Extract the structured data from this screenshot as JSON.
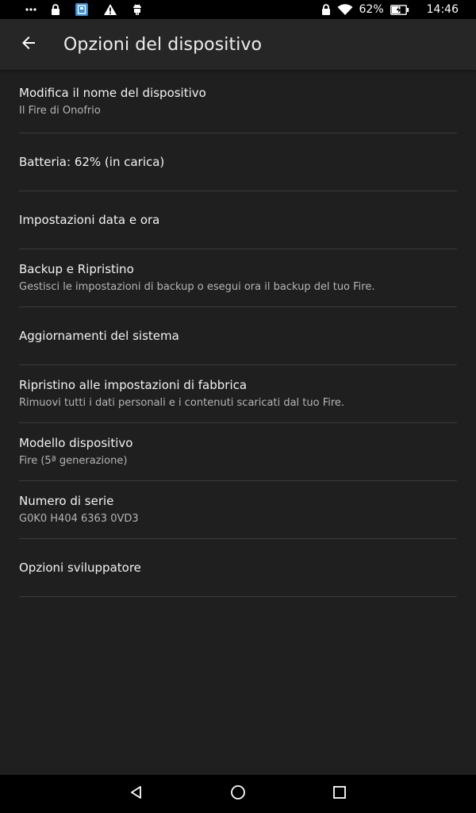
{
  "status_bar": {
    "icons_left": [
      "more-dots-icon",
      "lock-icon",
      "kindle-store-icon",
      "warning-icon",
      "android-debug-icon"
    ],
    "icons_right": [
      "lock-icon",
      "wifi-icon"
    ],
    "battery_percent_text": "62%",
    "battery_level": 0.62,
    "time": "14:46"
  },
  "app_bar": {
    "title": "Opzioni del dispositivo",
    "back_icon": "arrow-left-icon"
  },
  "settings": {
    "items": [
      {
        "title": "Modifica il nome del dispositivo",
        "subtitle": "Il Fire di Onofrio"
      },
      {
        "title": "Batteria: 62% (in carica)"
      },
      {
        "title": "Impostazioni data e ora"
      },
      {
        "title": "Backup e Ripristino",
        "subtitle": "Gestisci le impostazioni di backup o esegui ora il backup del tuo Fire."
      },
      {
        "title": "Aggiornamenti del sistema"
      },
      {
        "title": "Ripristino alle impostazioni di fabbrica",
        "subtitle": "Rimuovi tutti i dati personali e i contenuti scaricati dal tuo Fire."
      },
      {
        "title": "Modello dispositivo",
        "subtitle": "Fire (5ª generazione)"
      },
      {
        "title": "Numero di serie",
        "subtitle": "G0K0 H404 6363 0VD3"
      },
      {
        "title": "Opzioni sviluppatore"
      }
    ]
  },
  "nav_bar": {
    "icons": [
      "back-triangle-icon",
      "home-circle-icon",
      "recents-square-icon"
    ]
  },
  "colors": {
    "background": "#1f1f1f",
    "app_bar": "#262626",
    "divider": "#3a3a3a",
    "subtitle": "#b5b5b5"
  }
}
